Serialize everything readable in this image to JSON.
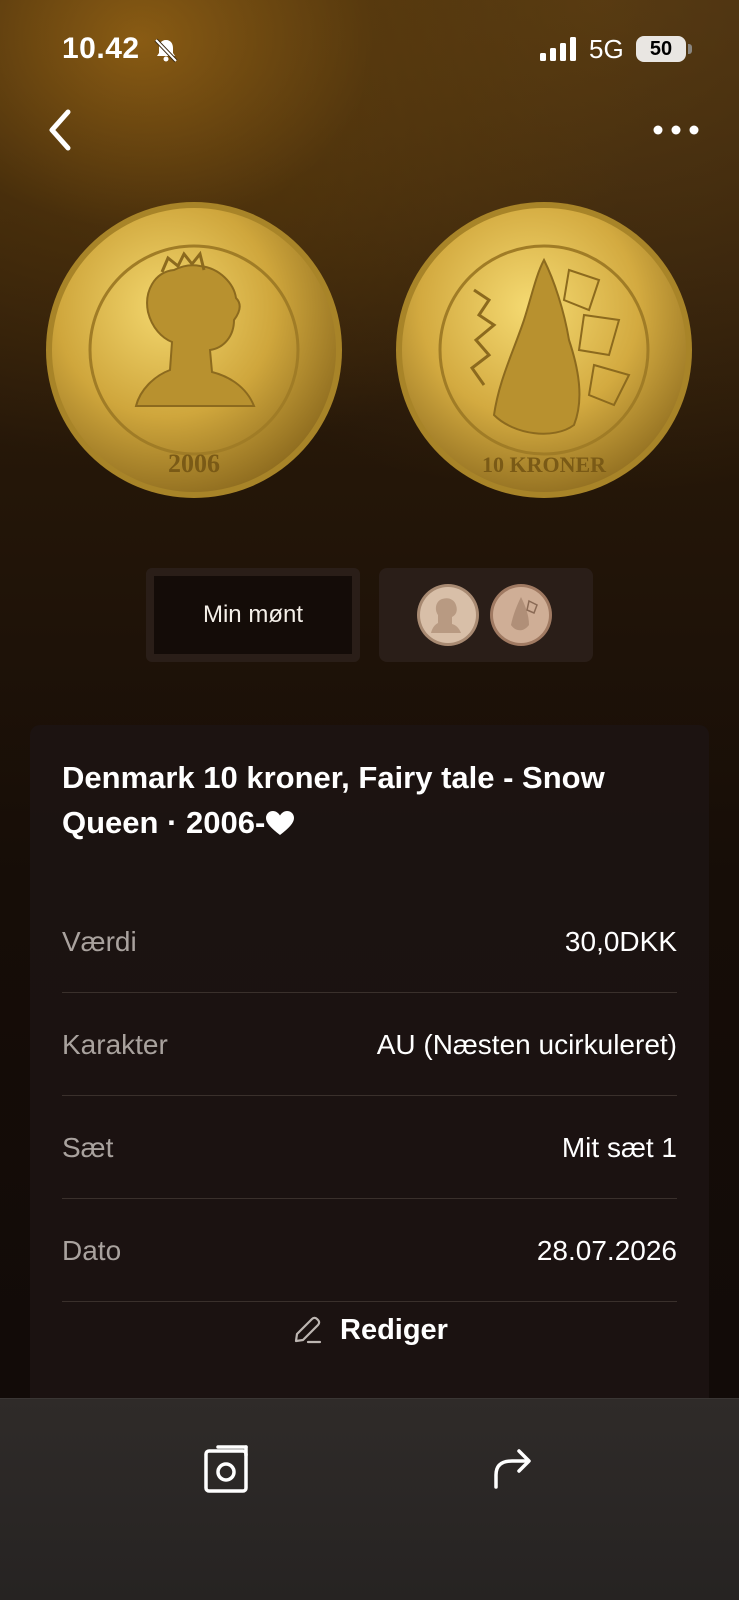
{
  "status_bar": {
    "time": "10.42",
    "network": "5G",
    "battery": "50"
  },
  "coin": {
    "title": "Denmark 10 kroner, Fairy tale - Snow Queen · 2006-",
    "obverse_icon": "coin-obverse-image",
    "reverse_icon": "coin-reverse-image"
  },
  "view_toggle": {
    "mine_label": "Min mønt"
  },
  "details": [
    {
      "label": "Værdi",
      "value": "30,0DKK"
    },
    {
      "label": "Karakter",
      "value": "AU (Næsten ucirkuleret)"
    },
    {
      "label": "Sæt",
      "value": "Mit sæt 1"
    },
    {
      "label": "Dato",
      "value": "28.07.2026"
    }
  ],
  "actions": {
    "edit_label": "Rediger"
  },
  "colors": {
    "gold": "#c9a23a",
    "card_bg": "#1c1412",
    "label_gray": "#a9a29e"
  }
}
